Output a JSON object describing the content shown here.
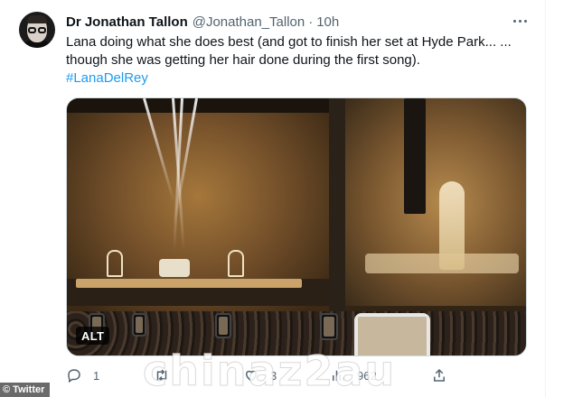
{
  "author": {
    "name": "Dr Jonathan Tallon",
    "handle": "@Jonathan_Tallon",
    "separator": "·",
    "time": "10h"
  },
  "tweet": {
    "line1": "Lana doing what she does best (and got to finish her set at Hyde Park... ...",
    "line2": "though she was getting her hair done during the first song).",
    "hashtag": "#LanaDelRey"
  },
  "media": {
    "alt_label": "ALT"
  },
  "actions": {
    "reply_count": "1",
    "retweet_count": "",
    "like_count": "3",
    "views_count": "962"
  },
  "overlay": {
    "watermark": "chinaz2au",
    "credit": "© Twitter"
  },
  "icons": {
    "more": "more-icon",
    "reply": "reply-icon",
    "retweet": "retweet-icon",
    "like": "like-icon",
    "views": "views-icon",
    "share": "share-icon"
  },
  "colors": {
    "text": "#0f1419",
    "secondary": "#536471",
    "accent": "#1d9bf0"
  }
}
